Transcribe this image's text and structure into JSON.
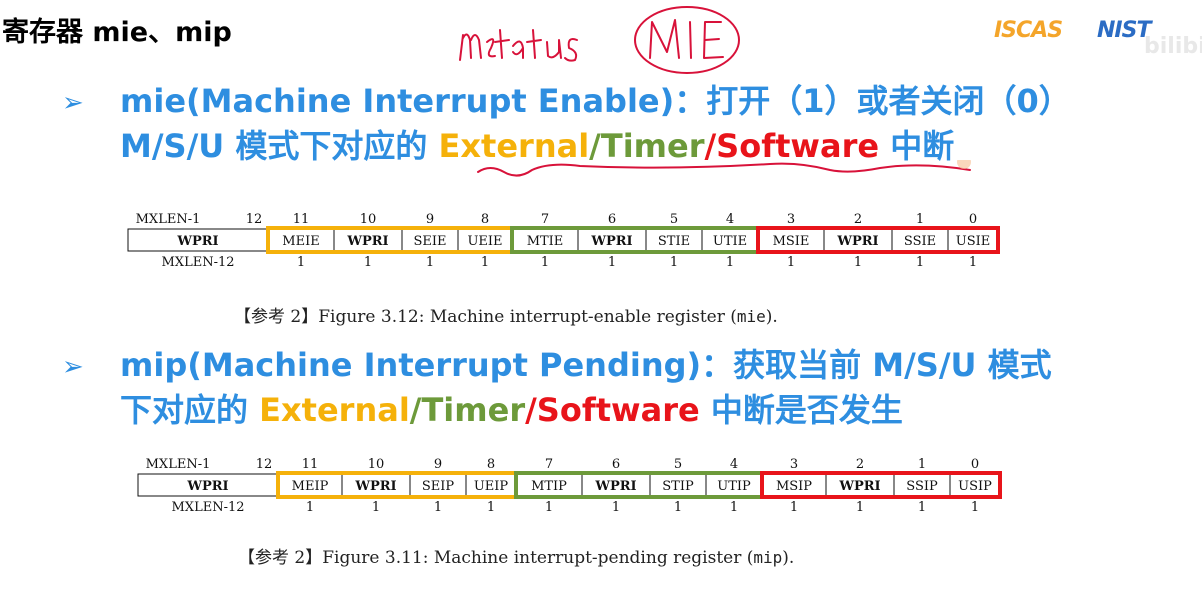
{
  "title": "寄存器 mie、mip",
  "logo": {
    "left": "ISCAS",
    "right": "NIST",
    "ghost": "bilibili"
  },
  "annotation": {
    "handwriting": "mstatus",
    "circled": "MIE"
  },
  "mie": {
    "line1": "mie(Machine Interrupt Enable)：打开（1）或者关闭（0）",
    "line2_prefix": "M/S/U 模式下对应的 ",
    "external": "External",
    "sep1": "/",
    "timer": "Timer",
    "sep2": "/",
    "software": "Software",
    "suffix": " 中断",
    "caption_prefix": "【参考 2】Figure 3.12: Machine interrupt-enable register (",
    "caption_code": "mie",
    "caption_suffix": ")."
  },
  "mip": {
    "line1": "mip(Machine Interrupt Pending)：获取当前 M/S/U 模式",
    "line2_prefix": "下对应的 ",
    "external": "External",
    "sep1": "/",
    "timer": "Timer",
    "sep2": "/",
    "software": "Software",
    "suffix": " 中断是否发生",
    "caption_prefix": "【参考 2】Figure 3.11: Machine interrupt-pending register (",
    "caption_code": "mip",
    "caption_suffix": ")."
  },
  "registers": {
    "mie": {
      "left_bit": "MXLEN-1",
      "left_name": "WPRI",
      "left_width": "MXLEN-12",
      "bits": [
        "12",
        "11",
        "10",
        "9",
        "8",
        "7",
        "6",
        "5",
        "4",
        "3",
        "2",
        "1",
        "0"
      ],
      "fields": [
        "MEIE",
        "WPRI",
        "SEIE",
        "UEIE",
        "MTIE",
        "WPRI",
        "STIE",
        "UTIE",
        "MSIE",
        "WPRI",
        "SSIE",
        "USIE"
      ],
      "widths": [
        "1",
        "1",
        "1",
        "1",
        "1",
        "1",
        "1",
        "1",
        "1",
        "1",
        "1",
        "1"
      ]
    },
    "mip": {
      "left_bit": "MXLEN-1",
      "left_name": "WPRI",
      "left_width": "MXLEN-12",
      "bits": [
        "12",
        "11",
        "10",
        "9",
        "8",
        "7",
        "6",
        "5",
        "4",
        "3",
        "2",
        "1",
        "0"
      ],
      "fields": [
        "MEIP",
        "WPRI",
        "SEIP",
        "UEIP",
        "MTIP",
        "WPRI",
        "STIP",
        "UTIP",
        "MSIP",
        "WPRI",
        "SSIP",
        "USIP"
      ],
      "widths": [
        "1",
        "1",
        "1",
        "1",
        "1",
        "1",
        "1",
        "1",
        "1",
        "1",
        "1",
        "1"
      ]
    }
  },
  "colors": {
    "blue": "#2e8ee0",
    "external": "#f5b10a",
    "timer": "#6d9a3a",
    "software": "#e8141a"
  }
}
